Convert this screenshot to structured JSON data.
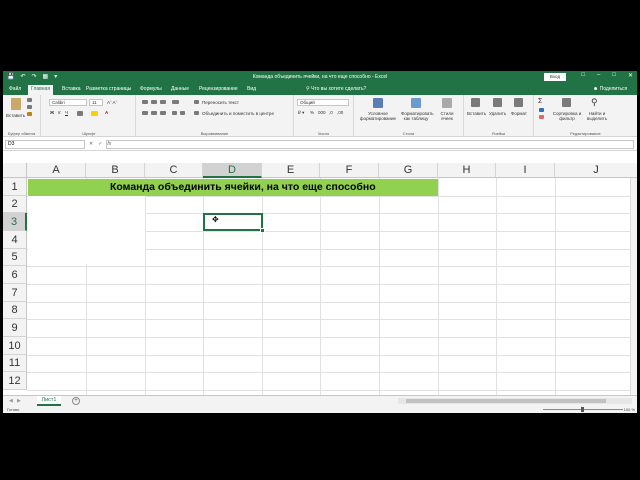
{
  "app": {
    "window_title": "Команда объединить ячейки, на что еще способно  -  Excel",
    "signin_label": "Вход",
    "share_label": "Поделиться",
    "search_hint": "Что вы хотите сделать?"
  },
  "tabs": [
    "Файл",
    "Главная",
    "Вставка",
    "Разметка страницы",
    "Формулы",
    "Данные",
    "Рецензирование",
    "Вид"
  ],
  "active_tab": "Главная",
  "ribbon": {
    "clipboard": {
      "paste": "Вставить",
      "label": "Буфер обмена"
    },
    "font": {
      "name": "Calibri",
      "size": "11",
      "label": "Шрифт"
    },
    "alignment": {
      "wrap": "Переносить текст",
      "merge": "Объединить и поместить в центре",
      "label": "Выравнивание"
    },
    "number": {
      "format": "Общий",
      "label": "Число"
    },
    "styles": {
      "conditional": "Условное форматирование",
      "as_table": "Форматировать как таблицу",
      "cell_styles": "Стили ячеек",
      "label": "Стили"
    },
    "cells": {
      "insert": "Вставить",
      "delete": "Удалить",
      "format": "Формат",
      "label": "Ячейки"
    },
    "editing": {
      "sort": "Сортировка и фильтр",
      "find": "Найти и выделить",
      "label": "Редактирование"
    }
  },
  "formula_bar": {
    "name_box": "D3",
    "content": ""
  },
  "columns": [
    "A",
    "B",
    "C",
    "D",
    "E",
    "F",
    "G",
    "H",
    "I",
    "J"
  ],
  "rows": [
    "1",
    "2",
    "3",
    "4",
    "5",
    "6",
    "7",
    "8",
    "9",
    "10",
    "11",
    "12"
  ],
  "cells": {
    "B1": "Команда объединить ячейки, на что еще способно"
  },
  "active_cell": "D3",
  "banner_color": "#92d050",
  "accent_color": "#217346",
  "sheets": [
    "Лист1"
  ],
  "status": {
    "ready": "Готово",
    "zoom": "100 %"
  }
}
